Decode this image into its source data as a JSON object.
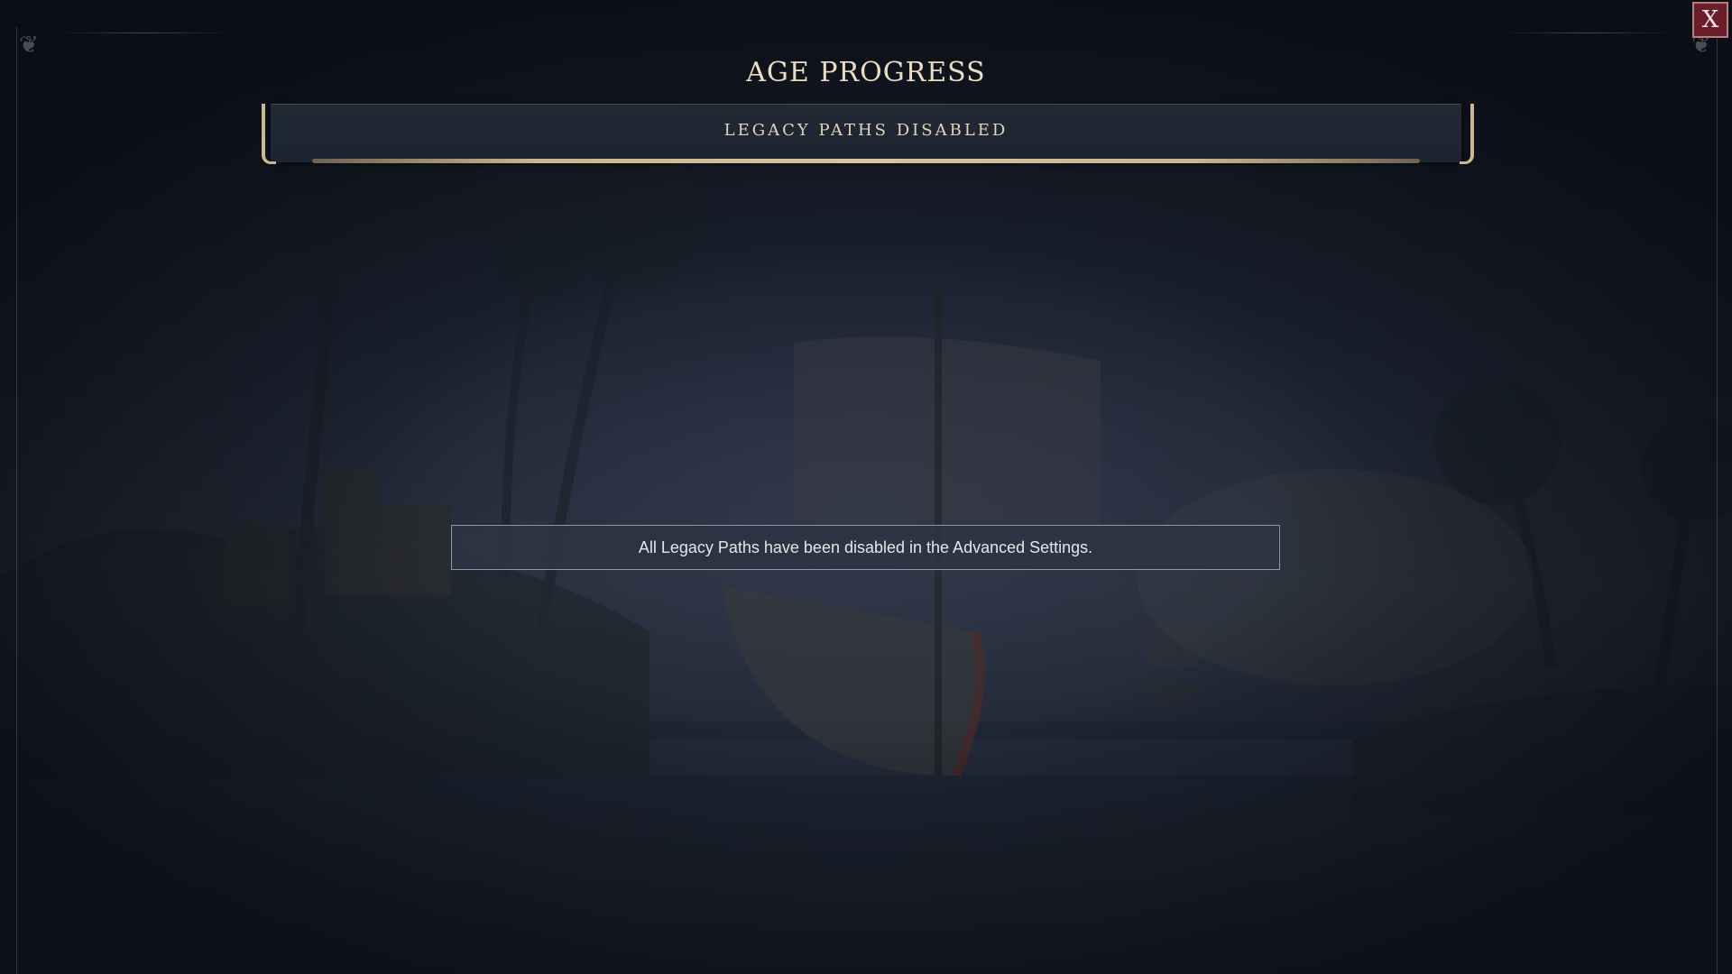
{
  "screen": {
    "title": "AGE PROGRESS",
    "banner_label": "LEGACY PATHS DISABLED",
    "message": "All Legacy Paths have been disabled in the Advanced Settings."
  },
  "close_button": {
    "label": "X",
    "icon": "close-icon"
  },
  "colors": {
    "title_text": "#e9dcc2",
    "banner_gold": "#cbb892",
    "close_button_bg": "#6a1e2a",
    "message_box_border": "#8f97a6"
  }
}
